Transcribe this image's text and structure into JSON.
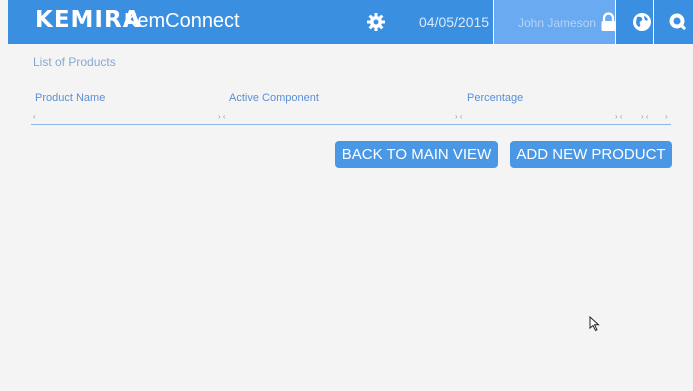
{
  "header": {
    "logo": "KEMIRA",
    "app_name": "KemConnect",
    "date": "04/05/2015",
    "user_name": "John Jameson",
    "icons": [
      "gear-icon",
      "lock-icon",
      "globe-icon",
      "search-icon"
    ]
  },
  "main": {
    "section_title": "List of Products",
    "table": {
      "columns": [
        "Product Name",
        "Active Component",
        "Percentage"
      ]
    },
    "buttons": {
      "back": "BACK TO MAIN VIEW",
      "add": "ADD NEW PRODUCT"
    }
  },
  "colors": {
    "accent": "#3b8fe0",
    "button": "#4a97e6",
    "background": "#f4f4f4"
  }
}
